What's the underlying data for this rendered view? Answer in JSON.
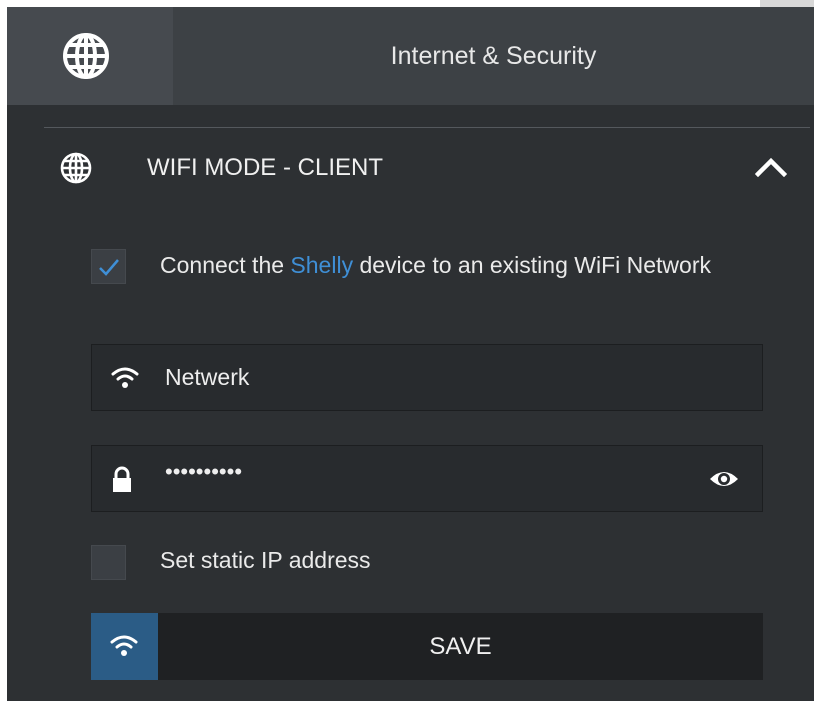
{
  "header": {
    "icon": "globe-icon",
    "title": "Internet & Security"
  },
  "section": {
    "icon": "globe-icon",
    "title": "WIFI MODE - CLIENT",
    "toggle_icon": "chevron-up-icon"
  },
  "connect_option": {
    "checked": true,
    "label_prefix": "Connect the ",
    "label_brand": "Shelly",
    "label_suffix": " device to an existing WiFi Network"
  },
  "ssid_field": {
    "icon": "wifi-icon",
    "value": "Netwerk"
  },
  "password_field": {
    "icon": "lock-icon",
    "value": "••••••••••",
    "toggle_icon": "eye-icon"
  },
  "static_ip_option": {
    "checked": false,
    "label": "Set static IP address"
  },
  "save": {
    "icon": "wifi-icon",
    "label": "SAVE"
  },
  "colors": {
    "background": "#2d3033",
    "header": "#3d4145",
    "accent": "#3f8fd6",
    "save_icon_bg": "#2b5c86"
  }
}
